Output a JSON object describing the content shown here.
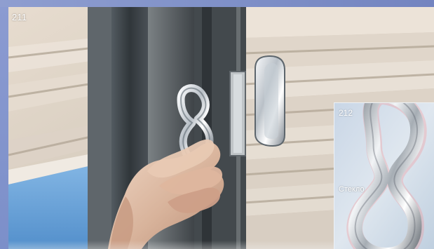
{
  "main_photo": {
    "number": "211"
  },
  "inset_photo": {
    "number": "212",
    "caption": "Стекло"
  }
}
